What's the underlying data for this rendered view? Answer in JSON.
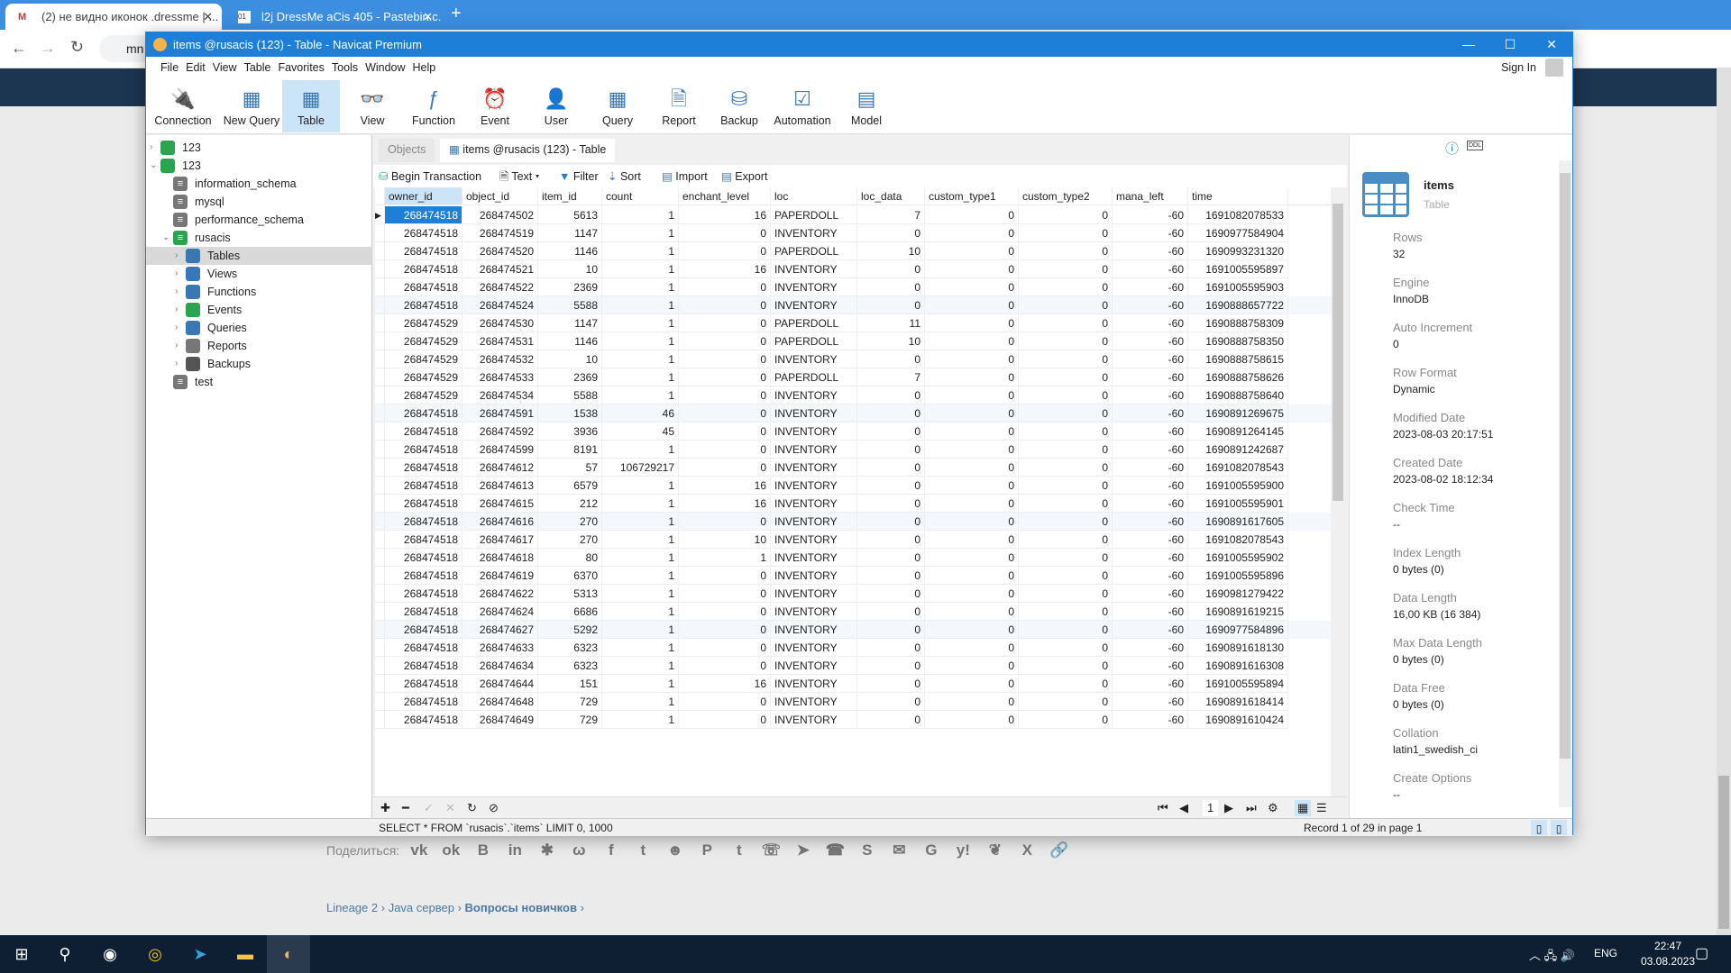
{
  "browser": {
    "tabs": [
      {
        "title": "(2) не видно иконок .dressme | ...",
        "icon": "mmo-favicon"
      },
      {
        "title": "l2j DressMe aCis 405 - Pastebin.c...",
        "icon": "pastebin-favicon"
      }
    ],
    "address": "mn"
  },
  "window": {
    "title": "items @rusacis (123) - Table - Navicat Premium",
    "accent": "#1e7fd8"
  },
  "menu": [
    "File",
    "Edit",
    "View",
    "Table",
    "Favorites",
    "Tools",
    "Window",
    "Help"
  ],
  "sign_in": "Sign In",
  "toolbar": [
    {
      "label": "Connection",
      "icon": "plug-icon"
    },
    {
      "label": "New Query",
      "icon": "new-query-icon"
    },
    {
      "label": "Table",
      "icon": "table-icon"
    },
    {
      "label": "View",
      "icon": "view-icon"
    },
    {
      "label": "Function",
      "icon": "function-icon"
    },
    {
      "label": "Event",
      "icon": "clock-icon"
    },
    {
      "label": "User",
      "icon": "user-icon"
    },
    {
      "label": "Query",
      "icon": "query-icon"
    },
    {
      "label": "Report",
      "icon": "report-icon"
    },
    {
      "label": "Backup",
      "icon": "backup-icon"
    },
    {
      "label": "Automation",
      "icon": "automation-icon"
    },
    {
      "label": "Model",
      "icon": "model-icon"
    }
  ],
  "tree": [
    {
      "label": "123",
      "level": 0,
      "arrow": "›",
      "icon": "connection"
    },
    {
      "label": "123",
      "level": 0,
      "arrow": "⌄",
      "icon": "connection"
    },
    {
      "label": "information_schema",
      "level": 1,
      "icon": "db"
    },
    {
      "label": "mysql",
      "level": 1,
      "icon": "db"
    },
    {
      "label": "performance_schema",
      "level": 1,
      "icon": "db"
    },
    {
      "label": "rusacis",
      "level": 1,
      "arrow": "⌄",
      "icon": "db-open"
    },
    {
      "label": "Tables",
      "level": 2,
      "arrow": "›",
      "icon": "tables",
      "selected": true
    },
    {
      "label": "Views",
      "level": 2,
      "arrow": "›",
      "icon": "views"
    },
    {
      "label": "Functions",
      "level": 2,
      "arrow": "›",
      "icon": "functions"
    },
    {
      "label": "Events",
      "level": 2,
      "arrow": "›",
      "icon": "events"
    },
    {
      "label": "Queries",
      "level": 2,
      "arrow": "›",
      "icon": "queries"
    },
    {
      "label": "Reports",
      "level": 2,
      "arrow": "›",
      "icon": "reports"
    },
    {
      "label": "Backups",
      "level": 2,
      "arrow": "›",
      "icon": "backups"
    },
    {
      "label": "test",
      "level": 1,
      "icon": "db"
    }
  ],
  "tabs": {
    "objects": "Objects",
    "active": "items @rusacis (123) - Table"
  },
  "content_toolbar": {
    "begin_transaction": "Begin Transaction",
    "text": "Text",
    "filter": "Filter",
    "sort": "Sort",
    "import": "Import",
    "export": "Export"
  },
  "table": {
    "columns": [
      "owner_id",
      "object_id",
      "item_id",
      "count",
      "enchant_level",
      "loc",
      "loc_data",
      "custom_type1",
      "custom_type2",
      "mana_left",
      "time"
    ],
    "rows": [
      [
        "268474518",
        "268474502",
        "5613",
        "1",
        "16",
        "PAPERDOLL",
        "7",
        "0",
        "0",
        "-60",
        "1691082078533"
      ],
      [
        "268474518",
        "268474519",
        "1147",
        "1",
        "0",
        "INVENTORY",
        "0",
        "0",
        "0",
        "-60",
        "1690977584904"
      ],
      [
        "268474518",
        "268474520",
        "1146",
        "1",
        "0",
        "PAPERDOLL",
        "10",
        "0",
        "0",
        "-60",
        "1690993231320"
      ],
      [
        "268474518",
        "268474521",
        "10",
        "1",
        "16",
        "INVENTORY",
        "0",
        "0",
        "0",
        "-60",
        "1691005595897"
      ],
      [
        "268474518",
        "268474522",
        "2369",
        "1",
        "0",
        "INVENTORY",
        "0",
        "0",
        "0",
        "-60",
        "1691005595903"
      ],
      [
        "268474518",
        "268474524",
        "5588",
        "1",
        "0",
        "INVENTORY",
        "0",
        "0",
        "0",
        "-60",
        "1690888657722"
      ],
      [
        "268474529",
        "268474530",
        "1147",
        "1",
        "0",
        "PAPERDOLL",
        "11",
        "0",
        "0",
        "-60",
        "1690888758309"
      ],
      [
        "268474529",
        "268474531",
        "1146",
        "1",
        "0",
        "PAPERDOLL",
        "10",
        "0",
        "0",
        "-60",
        "1690888758350"
      ],
      [
        "268474529",
        "268474532",
        "10",
        "1",
        "0",
        "INVENTORY",
        "0",
        "0",
        "0",
        "-60",
        "1690888758615"
      ],
      [
        "268474529",
        "268474533",
        "2369",
        "1",
        "0",
        "PAPERDOLL",
        "7",
        "0",
        "0",
        "-60",
        "1690888758626"
      ],
      [
        "268474529",
        "268474534",
        "5588",
        "1",
        "0",
        "INVENTORY",
        "0",
        "0",
        "0",
        "-60",
        "1690888758640"
      ],
      [
        "268474518",
        "268474591",
        "1538",
        "46",
        "0",
        "INVENTORY",
        "0",
        "0",
        "0",
        "-60",
        "1690891269675"
      ],
      [
        "268474518",
        "268474592",
        "3936",
        "45",
        "0",
        "INVENTORY",
        "0",
        "0",
        "0",
        "-60",
        "1690891264145"
      ],
      [
        "268474518",
        "268474599",
        "8191",
        "1",
        "0",
        "INVENTORY",
        "0",
        "0",
        "0",
        "-60",
        "1690891242687"
      ],
      [
        "268474518",
        "268474612",
        "57",
        "106729217",
        "0",
        "INVENTORY",
        "0",
        "0",
        "0",
        "-60",
        "1691082078543"
      ],
      [
        "268474518",
        "268474613",
        "6579",
        "1",
        "16",
        "INVENTORY",
        "0",
        "0",
        "0",
        "-60",
        "1691005595900"
      ],
      [
        "268474518",
        "268474615",
        "212",
        "1",
        "16",
        "INVENTORY",
        "0",
        "0",
        "0",
        "-60",
        "1691005595901"
      ],
      [
        "268474518",
        "268474616",
        "270",
        "1",
        "0",
        "INVENTORY",
        "0",
        "0",
        "0",
        "-60",
        "1690891617605"
      ],
      [
        "268474518",
        "268474617",
        "270",
        "1",
        "10",
        "INVENTORY",
        "0",
        "0",
        "0",
        "-60",
        "1691082078543"
      ],
      [
        "268474518",
        "268474618",
        "80",
        "1",
        "1",
        "INVENTORY",
        "0",
        "0",
        "0",
        "-60",
        "1691005595902"
      ],
      [
        "268474518",
        "268474619",
        "6370",
        "1",
        "0",
        "INVENTORY",
        "0",
        "0",
        "0",
        "-60",
        "1691005595896"
      ],
      [
        "268474518",
        "268474622",
        "5313",
        "1",
        "0",
        "INVENTORY",
        "0",
        "0",
        "0",
        "-60",
        "1690981279422"
      ],
      [
        "268474518",
        "268474624",
        "6686",
        "1",
        "0",
        "INVENTORY",
        "0",
        "0",
        "0",
        "-60",
        "1690891619215"
      ],
      [
        "268474518",
        "268474627",
        "5292",
        "1",
        "0",
        "INVENTORY",
        "0",
        "0",
        "0",
        "-60",
        "1690977584896"
      ],
      [
        "268474518",
        "268474633",
        "6323",
        "1",
        "0",
        "INVENTORY",
        "0",
        "0",
        "0",
        "-60",
        "1690891618130"
      ],
      [
        "268474518",
        "268474634",
        "6323",
        "1",
        "0",
        "INVENTORY",
        "0",
        "0",
        "0",
        "-60",
        "1690891616308"
      ],
      [
        "268474518",
        "268474644",
        "151",
        "1",
        "16",
        "INVENTORY",
        "0",
        "0",
        "0",
        "-60",
        "1691005595894"
      ],
      [
        "268474518",
        "268474648",
        "729",
        "1",
        "0",
        "INVENTORY",
        "0",
        "0",
        "0",
        "-60",
        "1690891618414"
      ],
      [
        "268474518",
        "268474649",
        "729",
        "1",
        "0",
        "INVENTORY",
        "0",
        "0",
        "0",
        "-60",
        "1690891610424"
      ]
    ]
  },
  "pager": {
    "page": "1"
  },
  "status": {
    "sql": "SELECT * FROM `rusacis`.`items` LIMIT 0, 1000",
    "record": "Record 1 of 29 in page 1"
  },
  "info": {
    "name": "items",
    "type": "Table",
    "fields": [
      {
        "label": "Rows",
        "value": "32"
      },
      {
        "label": "Engine",
        "value": "InnoDB"
      },
      {
        "label": "Auto Increment",
        "value": "0"
      },
      {
        "label": "Row Format",
        "value": "Dynamic"
      },
      {
        "label": "Modified Date",
        "value": "2023-08-03 20:17:51"
      },
      {
        "label": "Created Date",
        "value": "2023-08-02 18:12:34"
      },
      {
        "label": "Check Time",
        "value": "--"
      },
      {
        "label": "Index Length",
        "value": "0 bytes (0)"
      },
      {
        "label": "Data Length",
        "value": "16,00 KB (16 384)"
      },
      {
        "label": "Max Data Length",
        "value": "0 bytes (0)"
      },
      {
        "label": "Data Free",
        "value": "0 bytes (0)"
      },
      {
        "label": "Collation",
        "value": "latin1_swedish_ci"
      },
      {
        "label": "Create Options",
        "value": "--"
      }
    ]
  },
  "page": {
    "share_label": "Поделиться:",
    "share_icons": [
      "vk-icon",
      "odnoklassniki-icon",
      "blogger-icon",
      "linkedin-icon",
      "livejournal-icon",
      "weibo-icon",
      "facebook-icon",
      "twitter-icon",
      "reddit-icon",
      "pinterest-icon",
      "tumblr-icon",
      "whatsapp-icon",
      "telegram-icon",
      "viber-icon",
      "skype-icon",
      "email-icon",
      "google-icon",
      "yahoo-icon",
      "evernote-icon",
      "xing-icon",
      "link-icon"
    ],
    "breadcrumbs": [
      "Lineage 2",
      "Java сервер",
      "Вопросы новичков"
    ]
  },
  "taskbar": {
    "lang": "ENG",
    "time": "22:47",
    "date": "03.08.2023"
  }
}
